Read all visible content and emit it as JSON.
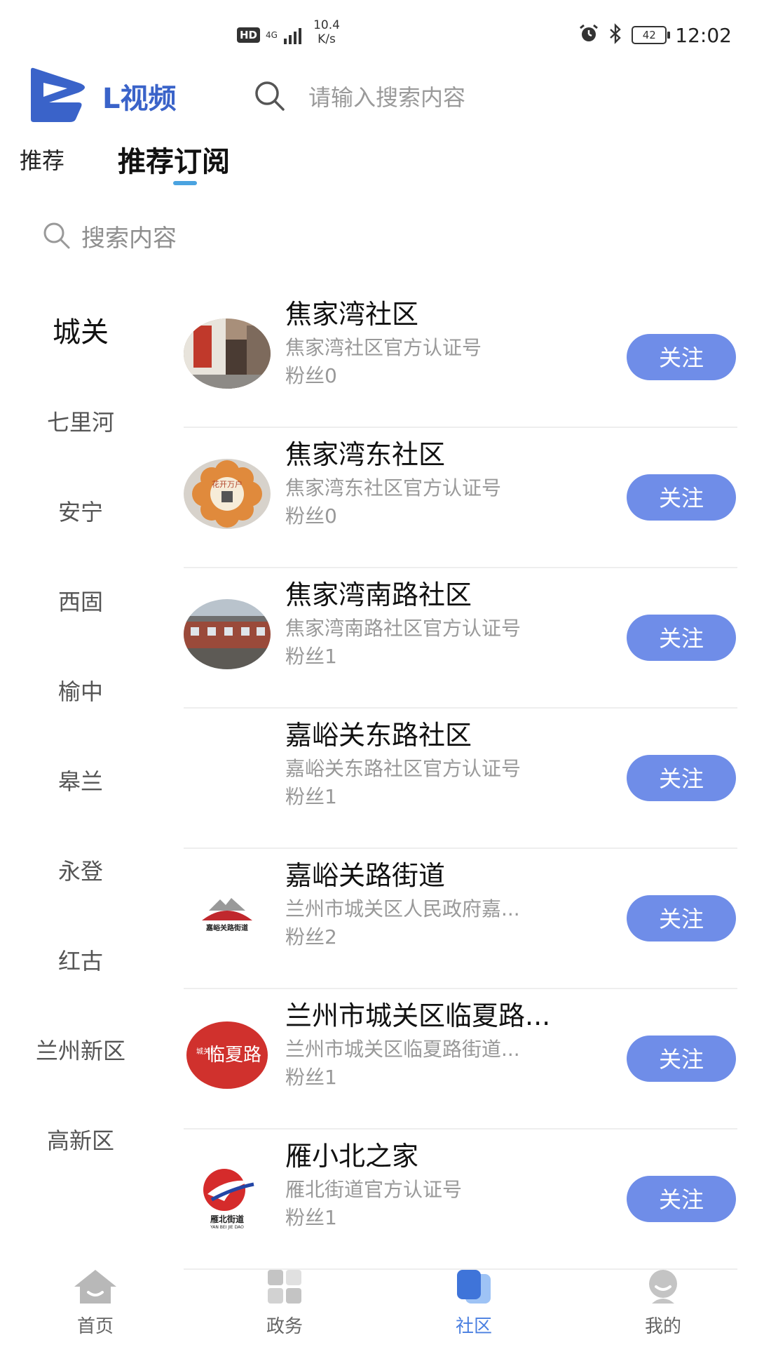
{
  "status_bar": {
    "hd": "HD",
    "network": "4G",
    "speed_value": "10.4",
    "speed_unit": "K/s",
    "battery": "42",
    "time": "12:02"
  },
  "header": {
    "app_name": "L视频",
    "search_placeholder": "请输入搜索内容"
  },
  "tabs": [
    {
      "label": "推荐",
      "active": false
    },
    {
      "label": "推荐订阅",
      "active": true
    }
  ],
  "content_search": {
    "placeholder": "搜索内容"
  },
  "categories": [
    "城关",
    "七里河",
    "安宁",
    "西固",
    "榆中",
    "皋兰",
    "永登",
    "红古",
    "兰州新区",
    "高新区"
  ],
  "selected_category": "城关",
  "list": [
    {
      "title": "焦家湾社区",
      "desc": "焦家湾社区官方认证号",
      "fans": "粉丝0",
      "button": "关注"
    },
    {
      "title": "焦家湾东社区",
      "desc": "焦家湾东社区官方认证号",
      "fans": "粉丝0",
      "button": "关注"
    },
    {
      "title": "焦家湾南路社区",
      "desc": "焦家湾南路社区官方认证号",
      "fans": "粉丝1",
      "button": "关注"
    },
    {
      "title": "嘉峪关东路社区",
      "desc": "嘉峪关东路社区官方认证号",
      "fans": "粉丝1",
      "button": "关注"
    },
    {
      "title": "嘉峪关路街道",
      "desc": "兰州市城关区人民政府嘉...",
      "fans": "粉丝2",
      "button": "关注"
    },
    {
      "title": "兰州市城关区临夏路...",
      "desc": "兰州市城关区临夏路街道...",
      "fans": "粉丝1",
      "button": "关注"
    },
    {
      "title": "雁小北之家",
      "desc": "雁北街道官方认证号",
      "fans": "粉丝1",
      "button": "关注"
    }
  ],
  "avatar_texts": {
    "huakai": "花开万户",
    "jiayuguan": "嘉峪关路街道",
    "linxia_big": "临夏路",
    "linxia_side": "城关区",
    "yanbei": "雁北街道",
    "yanbei_pinyin": "YAN BEI JIE DAO"
  },
  "bottom_nav": [
    {
      "label": "首页",
      "icon": "home-icon",
      "active": false
    },
    {
      "label": "政务",
      "icon": "grid-icon",
      "active": false
    },
    {
      "label": "社区",
      "icon": "community-icon",
      "active": true
    },
    {
      "label": "我的",
      "icon": "profile-icon",
      "active": false
    }
  ],
  "colors": {
    "accent": "#6f8de8",
    "brand": "#3a63c9",
    "tab_indicator": "#4aa3e0",
    "active_nav": "#4a7fe0"
  }
}
